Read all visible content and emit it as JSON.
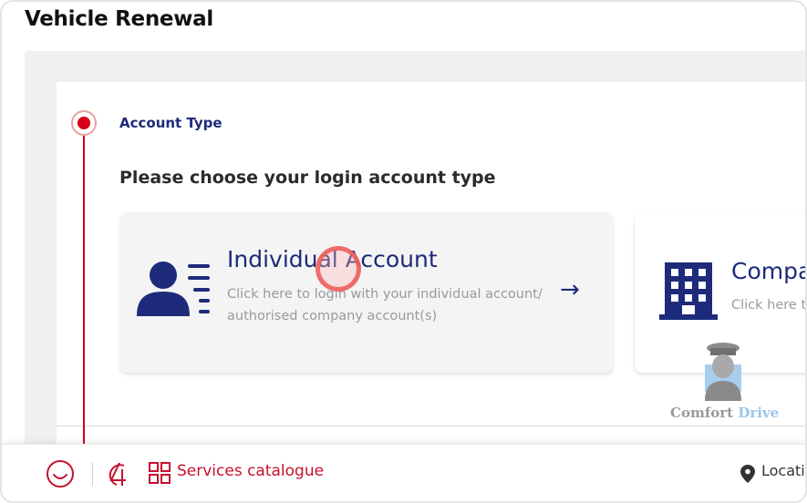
{
  "page": {
    "title": "Vehicle Renewal"
  },
  "stepper": {
    "step_label": "Account Type"
  },
  "main": {
    "heading": "Please choose your login account type"
  },
  "cards": {
    "individual": {
      "title": "Individual Account",
      "description_line1": "Click here to login with your individual account/",
      "description_line2": "authorised company account(s)",
      "icon": "user-list-icon",
      "arrow": "→"
    },
    "company": {
      "title": "Compa",
      "description": "Click here to",
      "icon": "building-icon"
    }
  },
  "watermark": {
    "word1": "Comfort",
    "word2": "Drive"
  },
  "bottom_bar": {
    "services_label": "Services catalogue",
    "location_label": "Locatio",
    "icons": [
      "smile-icon",
      "ai-chat-icon",
      "grid-icon",
      "location-pin-icon"
    ]
  },
  "colors": {
    "brand_red": "#c8102e",
    "navy": "#1d2b7a",
    "step_red": "#d7001a"
  }
}
